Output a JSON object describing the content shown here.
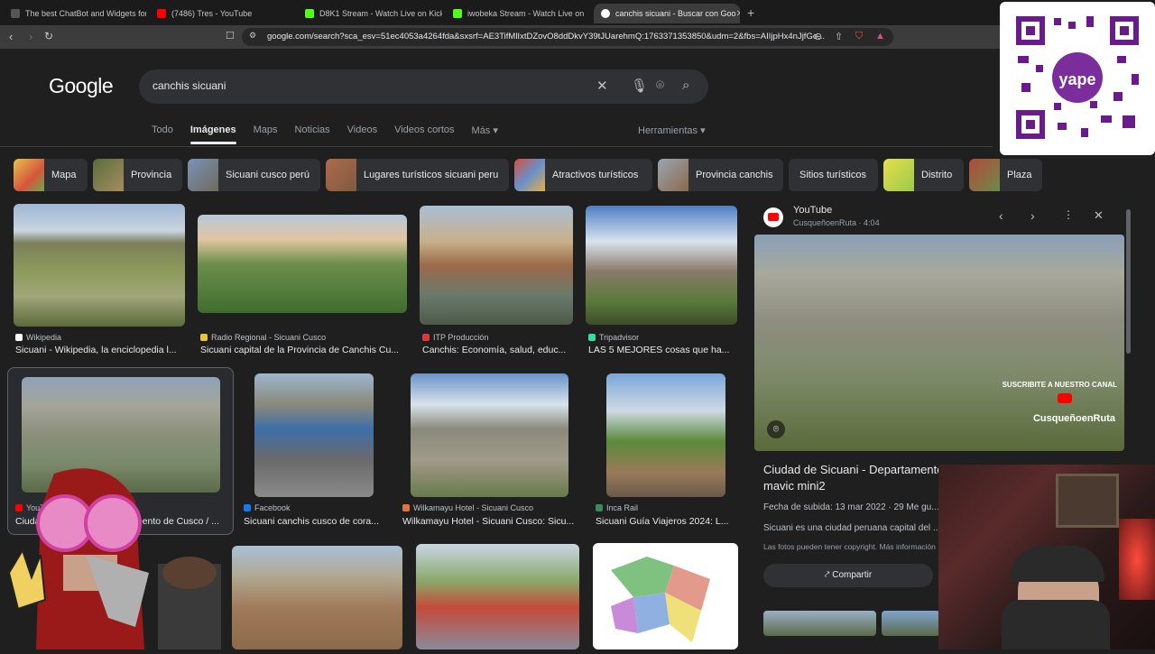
{
  "tabs": [
    {
      "title": "The best ChatBot and Widgets for Ki",
      "color": "#e8eaed"
    },
    {
      "title": "(7486) Tres - YouTube",
      "color": "#ff0000"
    },
    {
      "title": "D8K1 Stream - Watch Live on Kick",
      "color": "#53fc18"
    },
    {
      "title": "iwobeka Stream - Watch Live on",
      "color": "#53fc18"
    },
    {
      "title": "canchis sicuani - Buscar con Goo",
      "color": "#e8eaed"
    }
  ],
  "address": {
    "url": "google.com/search?sca_esv=51ec4053a4264fda&sxsrf=AE3TifMlIxtDZovO8ddDkvY39tJUarehmQ:1763371353850&udm=2&fbs=AIIjpHx4nJjfGo..."
  },
  "google": {
    "logo": "Google",
    "query": "canchis sicuani",
    "tabs": [
      "Todo",
      "Imágenes",
      "Maps",
      "Noticias",
      "Videos",
      "Videos cortos",
      "Más"
    ],
    "tools": "Herramientas"
  },
  "chips": [
    "Mapa",
    "Provincia",
    "Sicuani cusco perú",
    "Lugares turísticos sicuani peru",
    "Atractivos turísticos",
    "Provincia canchis",
    "Sitios turísticos",
    "Distrito",
    "Plaza"
  ],
  "results": [
    {
      "source": "Wikipedia",
      "caption": "Sicuani - Wikipedia, la enciclopedia l..."
    },
    {
      "source": "Radio Regional - Sicuani Cusco",
      "caption": "Sicuani capital de la Provincia de Canchis Cu..."
    },
    {
      "source": "ITP Producción",
      "caption": "Canchis: Economía, salud, educ..."
    },
    {
      "source": "Tripadvisor",
      "caption": "LAS 5 MEJORES cosas que ha..."
    },
    {
      "source": "YouTube",
      "caption": "Ciudad de Sicuani - Departamento de Cusco / ..."
    },
    {
      "source": "Facebook",
      "caption": "Sicuani canchis cusco de cora..."
    },
    {
      "source": "Wilkamayu Hotel - Sicuani Cusco",
      "caption": "Wilkamayu Hotel - Sicuani Cusco: Sicu..."
    },
    {
      "source": "Inca Rail",
      "caption": "Sicuani Guía Viajeros 2024: L..."
    }
  ],
  "panel": {
    "site": "YouTube",
    "channel": "CusqueñoenRuta · 4:04",
    "title": "Ciudad de Sicuani - Departamento de Cusco / Dji mavic mini2",
    "date": "Fecha de subida: 13 mar 2022 · 29 Me gu...",
    "desc": "Sicuani es una ciudad peruana capital del ...",
    "copyright": "Las fotos pueden tener copyright. Más información",
    "share": "Compartir",
    "overlay1": "SUSCRIBITE A NUESTRO CANAL",
    "overlay2": "CusqueñoenRuta"
  },
  "qr_label": "yape"
}
